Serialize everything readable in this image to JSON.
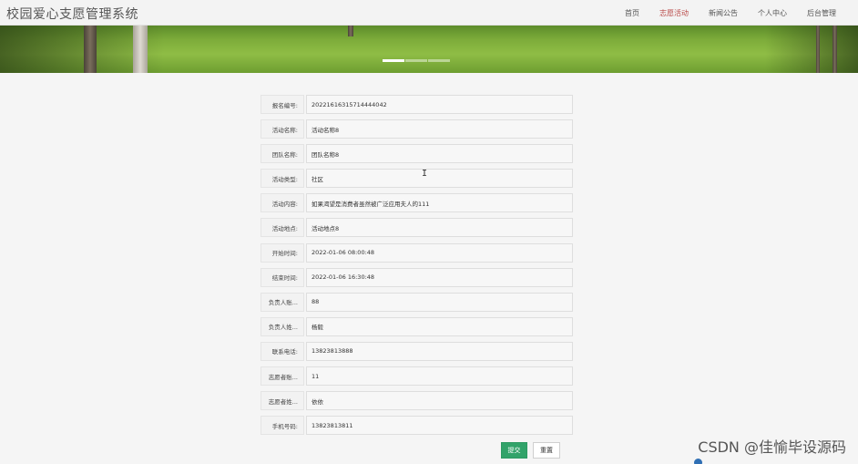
{
  "header": {
    "title": "校园爱心支愿管理系统",
    "nav": [
      {
        "label": "首页",
        "active": false
      },
      {
        "label": "志愿活动",
        "active": true
      },
      {
        "label": "新闻公告",
        "active": false
      },
      {
        "label": "个人中心",
        "active": false
      },
      {
        "label": "后台管理",
        "active": false
      }
    ]
  },
  "banner": {
    "slides": 3,
    "active_slide": 0
  },
  "form": {
    "fields": [
      {
        "label": "报名编号:",
        "value": "20221616315714444042"
      },
      {
        "label": "活动名称:",
        "value": "活动名称8"
      },
      {
        "label": "团队名称:",
        "value": "团队名称8"
      },
      {
        "label": "活动类型:",
        "value": "社区"
      },
      {
        "label": "活动内容:",
        "value": "如果渴望是消费者虽然被广泛应用夫人的111"
      },
      {
        "label": "活动地点:",
        "value": "活动地点8"
      },
      {
        "label": "开始时间:",
        "value": "2022-01-06 08:00:48"
      },
      {
        "label": "结束时间:",
        "value": "2022-01-06 16:30:48"
      },
      {
        "label": "负责人账...",
        "value": "88"
      },
      {
        "label": "负责人姓...",
        "value": "杨毅"
      },
      {
        "label": "联系电话:",
        "value": "13823813888"
      },
      {
        "label": "志愿者账...",
        "value": "11"
      },
      {
        "label": "志愿者姓...",
        "value": "依依"
      },
      {
        "label": "手机号码:",
        "value": "13823813811"
      }
    ],
    "submit_label": "提交",
    "reset_label": "重置"
  },
  "watermark": "CSDN @佳愉毕设源码",
  "colors": {
    "primary": "#32a36a",
    "nav_active": "#b94a48"
  }
}
